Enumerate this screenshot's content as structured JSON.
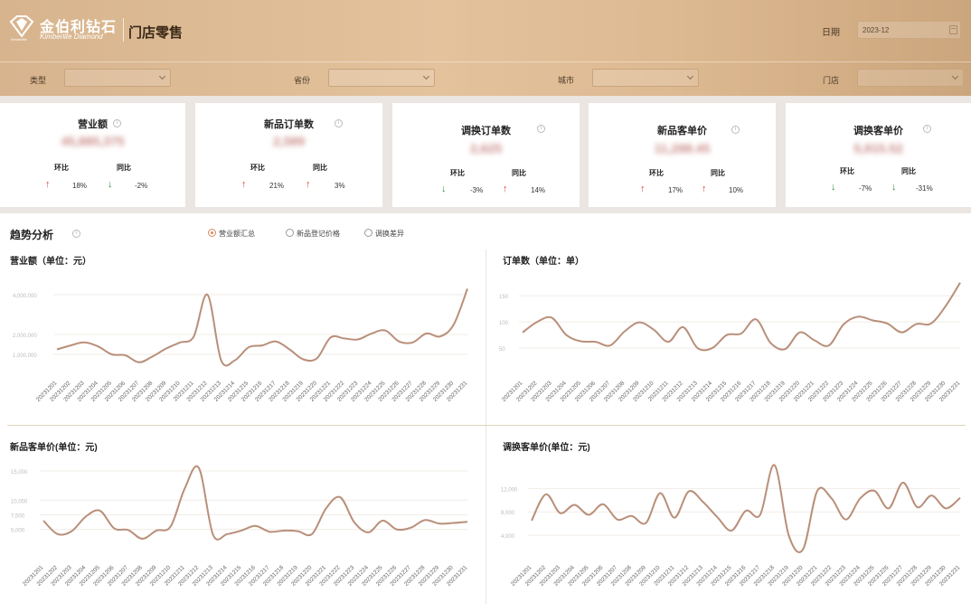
{
  "header": {
    "brand_cn": "金伯利钻石",
    "brand_en": "Kimberlite Diamond",
    "brand_small": "Kimberlite",
    "page_title": "门店零售",
    "date_label": "日期",
    "date_value": "2023-12"
  },
  "filters": [
    {
      "label": "类型",
      "value": ""
    },
    {
      "label": "省份",
      "value": ""
    },
    {
      "label": "城市",
      "value": ""
    },
    {
      "label": "门店",
      "value": ""
    }
  ],
  "kpis": [
    {
      "title": "营业额",
      "value": "45,885,375",
      "mom_label": "环比",
      "yoy_label": "同比",
      "mom": "18%",
      "mom_dir": "up",
      "yoy": "-2%",
      "yoy_dir": "down"
    },
    {
      "title": "新品订单数",
      "value": "2,589",
      "mom_label": "环比",
      "yoy_label": "同比",
      "mom": "21%",
      "mom_dir": "up",
      "yoy": "3%",
      "yoy_dir": "up"
    },
    {
      "title": "调换订单数",
      "value": "2,625",
      "mom_label": "环比",
      "yoy_label": "同比",
      "mom": "-3%",
      "mom_dir": "down",
      "yoy": "14%",
      "yoy_dir": "up"
    },
    {
      "title": "新品客单价",
      "value": "11,288.45",
      "mom_label": "环比",
      "yoy_label": "同比",
      "mom": "17%",
      "mom_dir": "up",
      "yoy": "10%",
      "yoy_dir": "up"
    },
    {
      "title": "调换客单价",
      "value": "5,915.52",
      "mom_label": "环比",
      "yoy_label": "同比",
      "mom": "-7%",
      "mom_dir": "down",
      "yoy": "-31%",
      "yoy_dir": "down"
    }
  ],
  "trend": {
    "title": "趋势分析",
    "options": [
      {
        "label": "营业额汇总",
        "selected": true
      },
      {
        "label": "新品登记价格",
        "selected": false
      },
      {
        "label": "调换差异",
        "selected": false
      }
    ]
  },
  "colors": {
    "line": "#b98f7a",
    "up": "#e0443a",
    "down": "#2e8b3e",
    "accent": "#d48a5c"
  },
  "chart_data": [
    {
      "type": "line",
      "title": "营业额（单位：元）",
      "x": [
        "20231201",
        "20231202",
        "20231203",
        "20231204",
        "20231205",
        "20231206",
        "20231207",
        "20231208",
        "20231209",
        "20231210",
        "20231211",
        "20231212",
        "20231213",
        "20231214",
        "20231215",
        "20231216",
        "20231217",
        "20231218",
        "20231219",
        "20231220",
        "20231221",
        "20231222",
        "20231223",
        "20231224",
        "20231225",
        "20231226",
        "20231227",
        "20231228",
        "20231229",
        "20231230",
        "20231231"
      ],
      "yticks": [
        "1,000,000",
        "2,000,000",
        "4,000,000"
      ],
      "ylim": [
        0,
        5000000
      ],
      "values": [
        1250000,
        1450000,
        1600000,
        1400000,
        1000000,
        950000,
        600000,
        900000,
        1300000,
        1600000,
        1900000,
        4000000,
        700000,
        700000,
        1350000,
        1450000,
        1650000,
        1250000,
        750000,
        800000,
        1850000,
        1800000,
        1750000,
        2050000,
        2200000,
        1650000,
        1600000,
        2050000,
        1900000,
        2500000,
        4300000
      ],
      "grid": true
    },
    {
      "type": "line",
      "title": "订单数（单位：单）",
      "x": [
        "20231201",
        "20231202",
        "20231203",
        "20231204",
        "20231205",
        "20231206",
        "20231207",
        "20231208",
        "20231209",
        "20231210",
        "20231211",
        "20231212",
        "20231213",
        "20231214",
        "20231215",
        "20231216",
        "20231217",
        "20231218",
        "20231219",
        "20231220",
        "20231221",
        "20231222",
        "20231223",
        "20231224",
        "20231225",
        "20231226",
        "20231227",
        "20231228",
        "20231229",
        "20231230",
        "20231231"
      ],
      "yticks": [
        "50",
        "100",
        "150"
      ],
      "ylim": [
        0,
        190
      ],
      "values": [
        80,
        100,
        108,
        75,
        63,
        62,
        55,
        82,
        99,
        85,
        62,
        90,
        50,
        50,
        75,
        78,
        105,
        60,
        48,
        80,
        65,
        55,
        95,
        110,
        103,
        97,
        80,
        96,
        97,
        130,
        175
      ],
      "grid": true
    },
    {
      "type": "line",
      "title": "新品客单价(单位：元)",
      "x": [
        "20231201",
        "20231202",
        "20231203",
        "20231204",
        "20231205",
        "20231206",
        "20231207",
        "20231208",
        "20231209",
        "20231210",
        "20231211",
        "20231212",
        "20231213",
        "20231214",
        "20231215",
        "20231216",
        "20231217",
        "20231218",
        "20231219",
        "20231220",
        "20231221",
        "20231222",
        "20231223",
        "20231224",
        "20231225",
        "20231226",
        "20231227",
        "20231228",
        "20231229",
        "20231230",
        "20231231"
      ],
      "yticks": [
        "5,000",
        "7,500",
        "10,000",
        "15,000"
      ],
      "ylim": [
        0,
        17000
      ],
      "values": [
        6500,
        4200,
        4700,
        7200,
        8200,
        5200,
        4900,
        3400,
        4800,
        5500,
        12000,
        15500,
        4100,
        4200,
        4800,
        5600,
        4600,
        4800,
        4700,
        4200,
        8600,
        10500,
        6200,
        4500,
        6500,
        5000,
        5300,
        6600,
        6000,
        6100,
        6300
      ],
      "grid": true
    },
    {
      "type": "line",
      "title": "调换客单价(单位：元)",
      "x": [
        "20231201",
        "20231202",
        "20231203",
        "20231204",
        "20231205",
        "20231206",
        "20231207",
        "20231208",
        "20231209",
        "20231210",
        "20231211",
        "20231212",
        "20231213",
        "20231214",
        "20231215",
        "20231216",
        "20231217",
        "20231218",
        "20231219",
        "20231220",
        "20231221",
        "20231222",
        "20231223",
        "20231224",
        "20231225",
        "20231226",
        "20231227",
        "20231228",
        "20231229",
        "20231230",
        "20231231"
      ],
      "yticks": [
        "4,000",
        "8,000",
        "12,000"
      ],
      "ylim": [
        0,
        17000
      ],
      "values": [
        6500,
        11000,
        7800,
        9200,
        7500,
        9300,
        6700,
        7300,
        6100,
        11200,
        7000,
        11500,
        9700,
        7100,
        4800,
        8200,
        7500,
        16000,
        4000,
        1600,
        11600,
        10300,
        6700,
        10300,
        11600,
        8600,
        13000,
        8800,
        10800,
        8600,
        10400
      ],
      "grid": true
    }
  ]
}
